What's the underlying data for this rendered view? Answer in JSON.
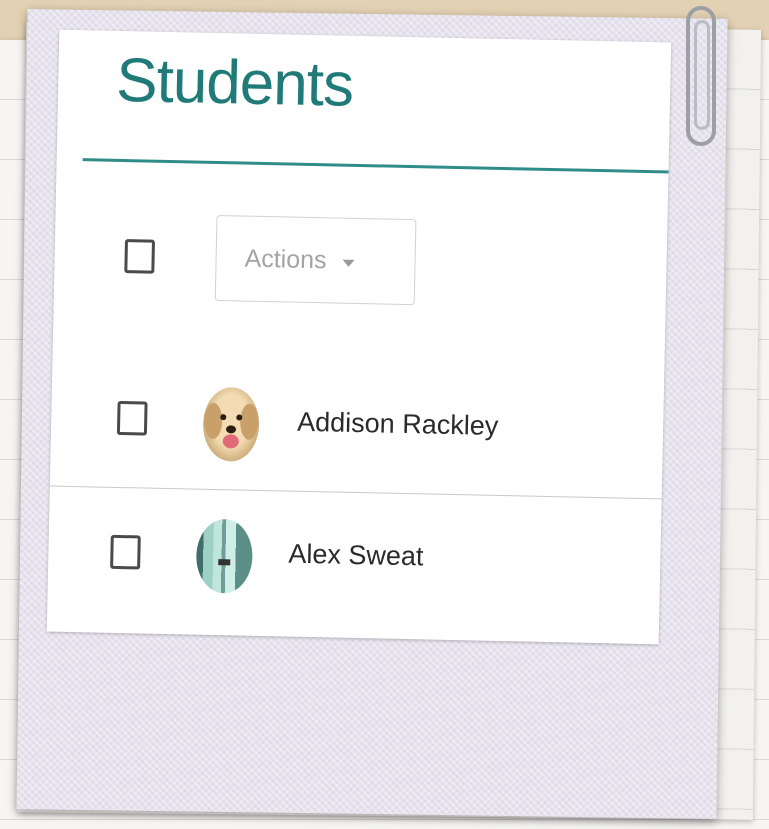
{
  "page": {
    "title": "Students"
  },
  "toolbar": {
    "actions_label": "Actions"
  },
  "students": [
    {
      "name": "Addison Rackley",
      "avatar": "dog-avatar"
    },
    {
      "name": "Alex Sweat",
      "avatar": "photo-avatar"
    }
  ],
  "colors": {
    "accent": "#1f7a78",
    "rule": "#2f8c89",
    "frame": "#e6e2ee",
    "background": "#e3d1b3"
  }
}
